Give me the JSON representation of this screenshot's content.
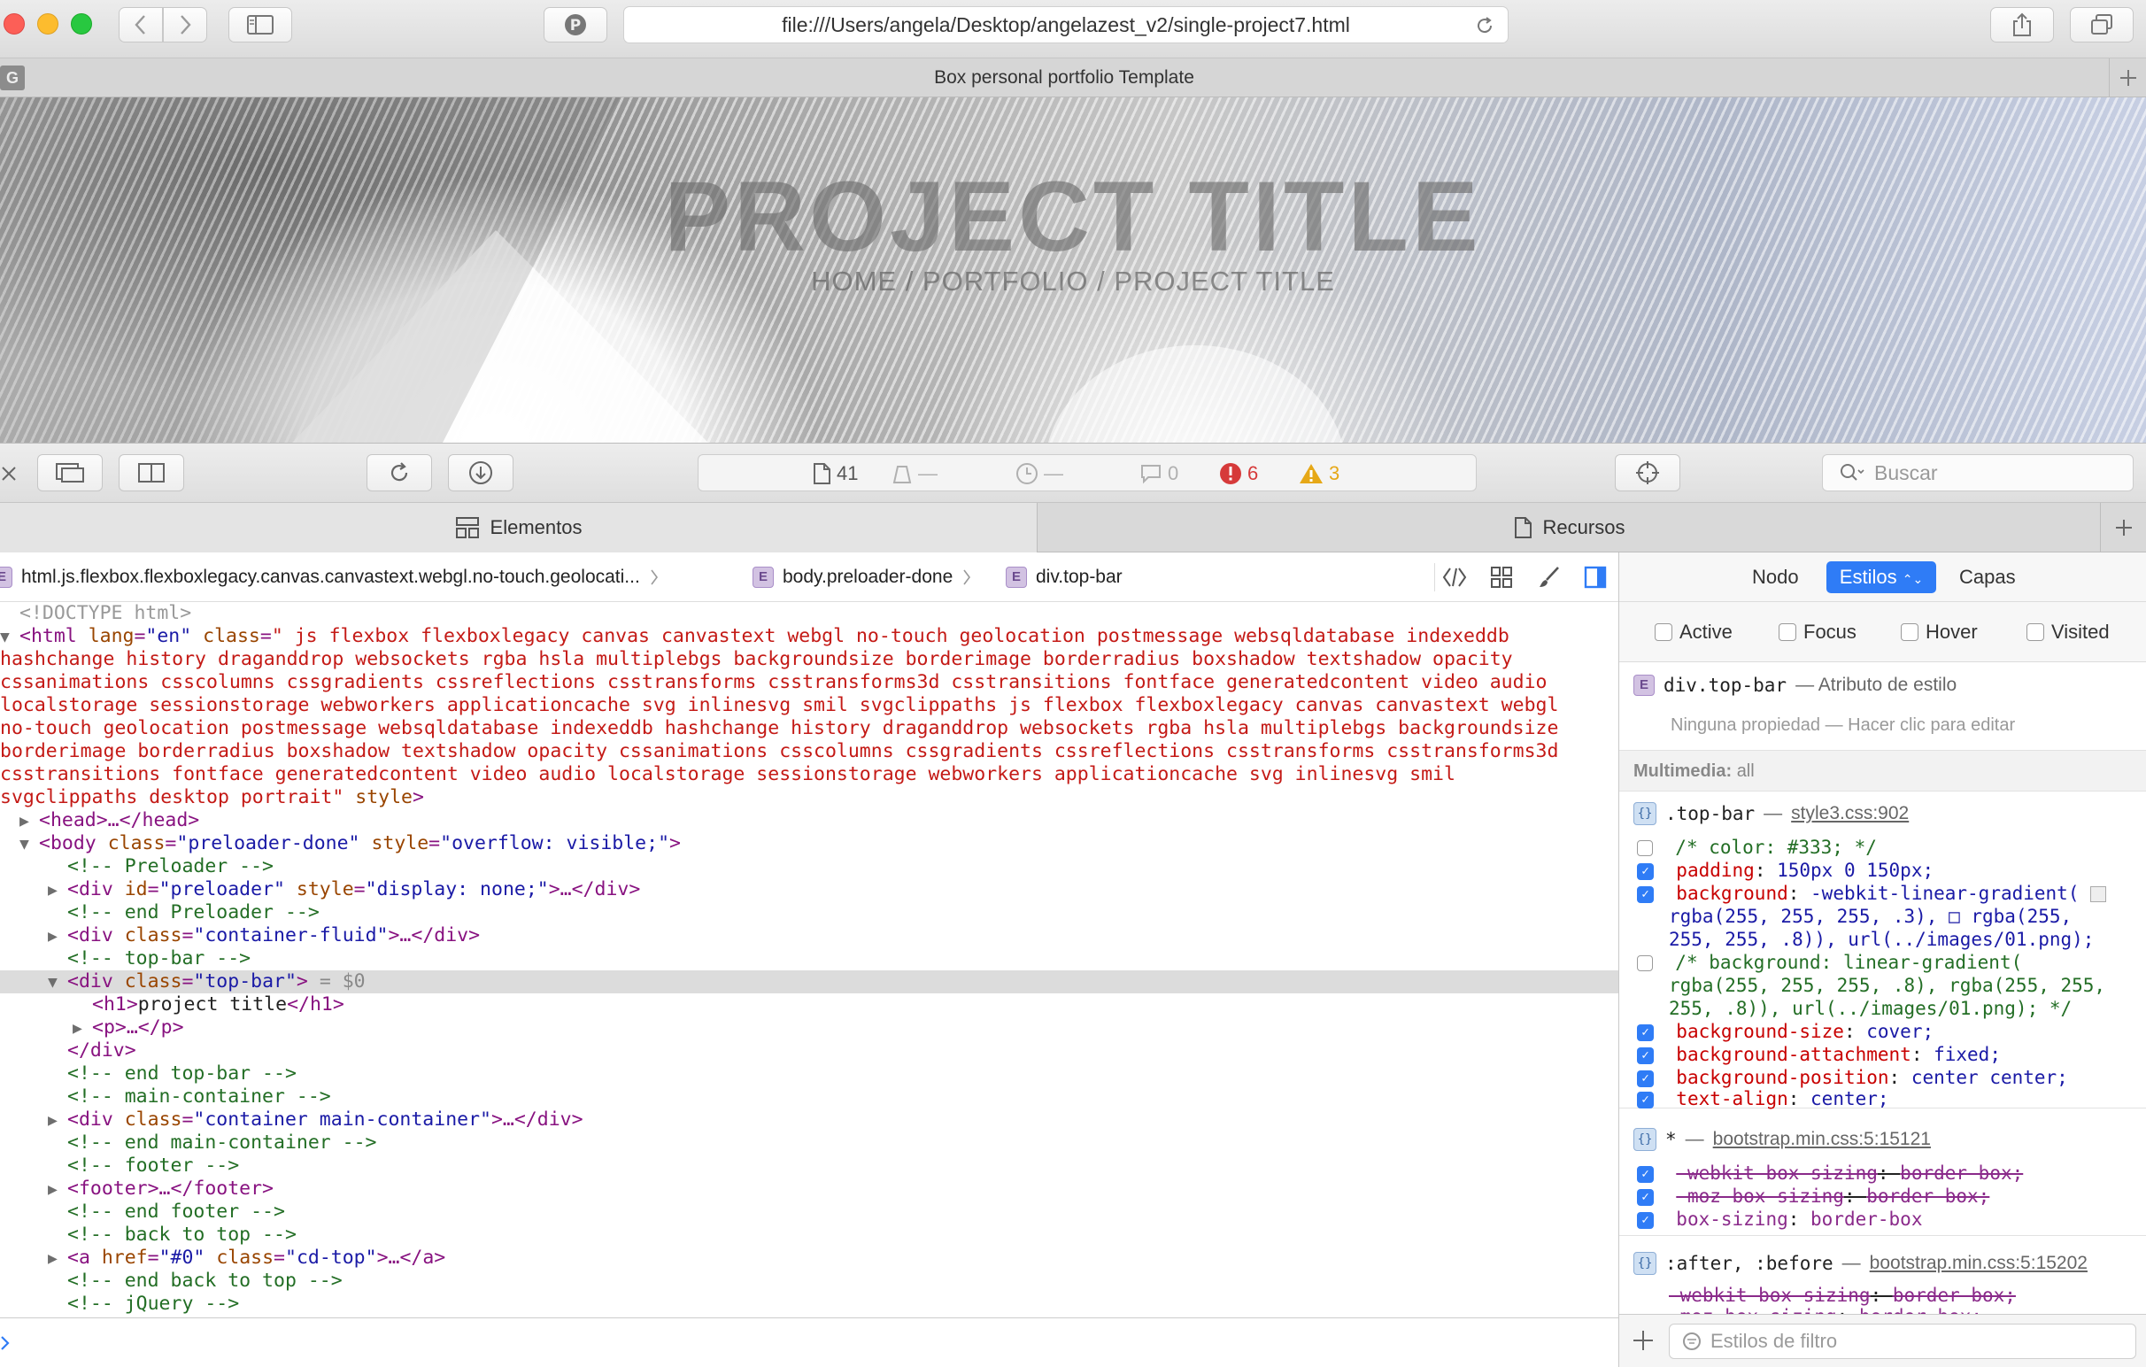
{
  "browser": {
    "url": "file:///Users/angela/Desktop/angelazest_v2/single-project7.html",
    "tab_title": "Box personal portfolio Template",
    "favicon_letter": "G",
    "colors": {
      "close": "#fc5f57",
      "minimize": "#fdbc2e",
      "maximize": "#28c840"
    }
  },
  "hero": {
    "title": "PROJECT TITLE",
    "breadcrumb": "HOME / PORTFOLIO / PROJECT TITLE"
  },
  "toolbar": {
    "resources_count": "41",
    "size": "—",
    "time": "—",
    "logs": "0",
    "errors": "6",
    "warnings": "3",
    "search_placeholder": "Buscar",
    "colors": {
      "error": "#d63a3a",
      "warning": "#e6a817"
    }
  },
  "tabs": {
    "elements": "Elementos",
    "resources": "Recursos"
  },
  "breadcrumb": {
    "items": [
      "html.js.flexbox.flexboxlegacy.canvas.canvastext.webgl.no-touch.geolocati...",
      "body.preloader-done",
      "div.top-bar"
    ]
  },
  "dom": {
    "doctype": "<!DOCTYPE html>",
    "html_open": "<html",
    "html_lang_attr": "lang",
    "html_lang_val": "\"en\"",
    "html_class_attr": "class",
    "html_class_lines": [
      "\" js flexbox flexboxlegacy canvas canvastext webgl no-touch geolocation postmessage websqldatabase indexeddb",
      "hashchange history draganddrop websockets rgba hsla multiplebgs backgroundsize borderimage borderradius boxshadow textshadow opacity",
      "cssanimations csscolumns cssgradients cssreflections csstransforms csstransforms3d csstransitions fontface generatedcontent video audio",
      "localstorage sessionstorage webworkers applicationcache svg inlinesvg smil svgclippaths js flexbox flexboxlegacy canvas canvastext webgl",
      "no-touch geolocation postmessage websqldatabase indexeddb hashchange history draganddrop websockets rgba hsla multiplebgs backgroundsize",
      "borderimage borderradius boxshadow textshadow opacity cssanimations csscolumns cssgradients cssreflections csstransforms csstransforms3d",
      "csstransitions fontface generatedcontent video audio localstorage sessionstorage webworkers applicationcache svg inlinesvg smil",
      "svgclippaths desktop portrait\""
    ],
    "html_style_attr": "style",
    "head": "<head>…</head>",
    "body_open_tag": "<body",
    "body_class_val": "\"preloader-done\"",
    "body_style_val": "\"overflow: visible;\"",
    "c_preloader": "<!-- Preloader -->",
    "preloader_div_id": "\"preloader\"",
    "preloader_div_style": "\"display: none;\"",
    "c_end_preloader": "<!-- end Preloader -->",
    "container_fluid_val": "\"container-fluid\"",
    "c_top_bar": "<!-- top-bar -->",
    "top_bar_val": "\"top-bar\"",
    "sel_marker": " = $0",
    "h1_open": "<h1>",
    "h1_text": "project title",
    "h1_close": "</h1>",
    "p_collapsed": "<p>…</p>",
    "div_close": "</div>",
    "c_end_top_bar": "<!-- end top-bar -->",
    "c_main_container": "<!-- main-container -->",
    "main_container_val": "\"container main-container\"",
    "c_end_main_container": "<!-- end main-container -->",
    "c_footer": "<!-- footer -->",
    "footer_collapsed": "<footer>…</footer>",
    "c_end_footer": "<!-- end footer -->",
    "c_back_to_top": "<!-- back to top -->",
    "a_href_val": "\"#0\"",
    "a_class_val": "\"cd-top\"",
    "c_end_back_to_top": "<!-- end back to top -->",
    "c_jquery": "<!-- jQuery -->"
  },
  "sidebar": {
    "tabs": {
      "node": "Nodo",
      "styles": "Estilos",
      "layers": "Capas"
    },
    "pseudo": [
      "Active",
      "Focus",
      "Hover",
      "Visited"
    ],
    "inline": {
      "selector": "div.top-bar",
      "note": "— Atributo de estilo",
      "empty": "Ninguna propiedad — Hacer clic para editar"
    },
    "media": {
      "label": "Multimedia:",
      "value": "all"
    },
    "rule1": {
      "selector": ".top-bar",
      "source": "style3.css:902",
      "lines": [
        {
          "text": "/* color: #333; */",
          "checked": false
        },
        {
          "prop": "padding",
          "value": "150px 0 150px;",
          "checked": true
        },
        {
          "prop": "background",
          "value": "-webkit-linear-gradient(",
          "checked": true
        },
        {
          "text": "rgba(255, 255, 255, .3), □ rgba(255,",
          "checked": null
        },
        {
          "text": "255, 255, .8)), url(../images/01.png);",
          "checked": null
        },
        {
          "text": "/* background: linear-gradient(",
          "checked": false
        },
        {
          "text": "rgba(255, 255, 255, .8), rgba(255, 255,",
          "checked": null
        },
        {
          "text": "255, .8)), url(../images/01.png); */",
          "checked": null
        },
        {
          "prop": "background-size",
          "value": "cover;",
          "checked": true
        },
        {
          "prop": "background-attachment",
          "value": "fixed;",
          "checked": true
        },
        {
          "prop": "background-position",
          "value": "center center;",
          "checked": true
        },
        {
          "prop": "text-align",
          "value": "center;",
          "checked": true
        }
      ]
    },
    "rule2": {
      "selector": "*",
      "source": "bootstrap.min.css:5:15121",
      "lines": [
        {
          "prop": "-webkit-box-sizing",
          "value": "border-box;",
          "strike": true
        },
        {
          "prop": "-moz-box-sizing",
          "value": "border-box;",
          "strike": true
        },
        {
          "prop": "box-sizing",
          "value": "border-box",
          "strike": false
        }
      ]
    },
    "rule3": {
      "selector": ":after, :before",
      "source": "bootstrap.min.css:5:15202",
      "lines": [
        {
          "prop": "-webkit-box-sizing",
          "value": "border-box;",
          "strike": true
        },
        {
          "prop": "-moz-box-sizing",
          "value": "border-box;",
          "strike": true
        }
      ]
    },
    "filter_placeholder": "Estilos de filtro"
  }
}
